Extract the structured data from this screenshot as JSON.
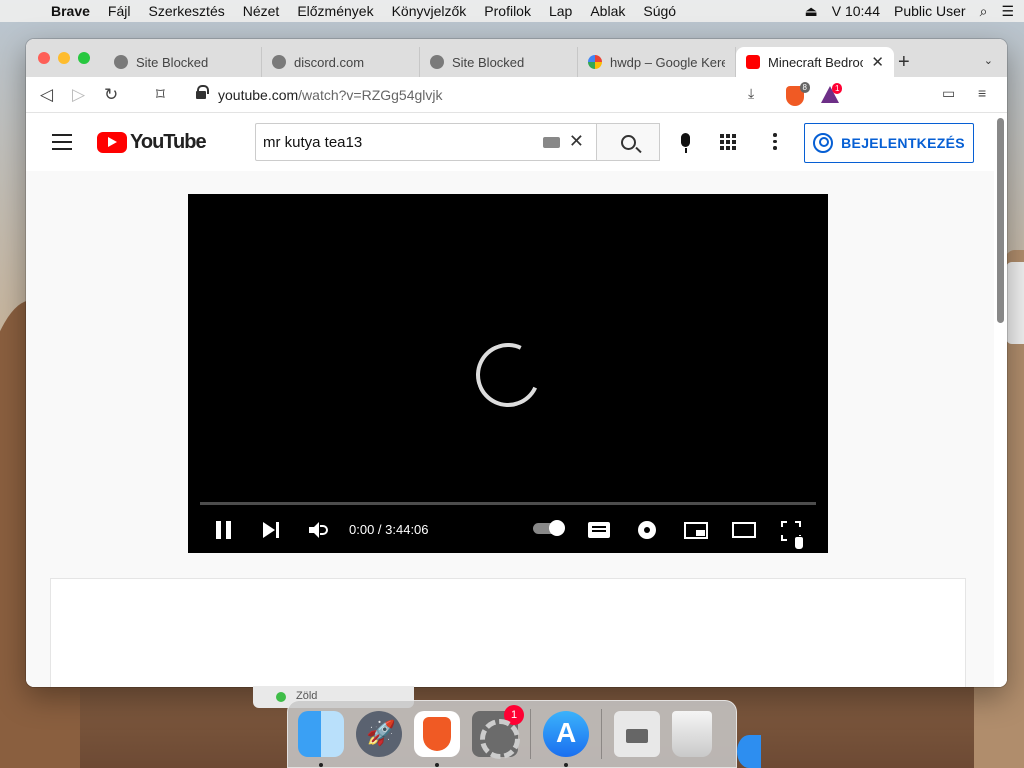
{
  "menubar": {
    "app_name": "Brave",
    "items": [
      "Fájl",
      "Szerkesztés",
      "Nézet",
      "Előzmények",
      "Könyvjelzők",
      "Profilok",
      "Lap",
      "Ablak",
      "Súgó"
    ],
    "clock": "V 10:44",
    "user": "Public User"
  },
  "tabs": [
    {
      "title": "Site Blocked",
      "icon": "globe-icon",
      "active": false
    },
    {
      "title": "discord.com",
      "icon": "globe-icon",
      "active": false
    },
    {
      "title": "Site Blocked",
      "icon": "globe-icon",
      "active": false
    },
    {
      "title": "hwdp – Google Keres",
      "icon": "google-icon",
      "active": false
    },
    {
      "title": "Minecraft Bedroc",
      "icon": "youtube-icon",
      "active": true
    }
  ],
  "toolbar": {
    "url_host": "youtube.com",
    "url_path": "/watch?v=RZGg54glvjk",
    "shield_count": "8",
    "rewards_count": "1"
  },
  "youtube": {
    "logo_text": "YouTube",
    "search_value": "mr kutya tea13",
    "signin_label": "BEJELENTKEZÉS"
  },
  "player": {
    "time_display": "0:00 / 3:44:06",
    "progress": 0
  },
  "behind_window": {
    "label": "Zöld"
  },
  "dock": {
    "apps": [
      "finder",
      "launchpad",
      "brave",
      "system-preferences",
      "app-store",
      "disk",
      "trash"
    ],
    "sysprefs_badge": "1"
  },
  "colors": {
    "youtube_red": "#ff0000",
    "signin_blue": "#065fd4",
    "brave_orange": "#f05a24"
  }
}
